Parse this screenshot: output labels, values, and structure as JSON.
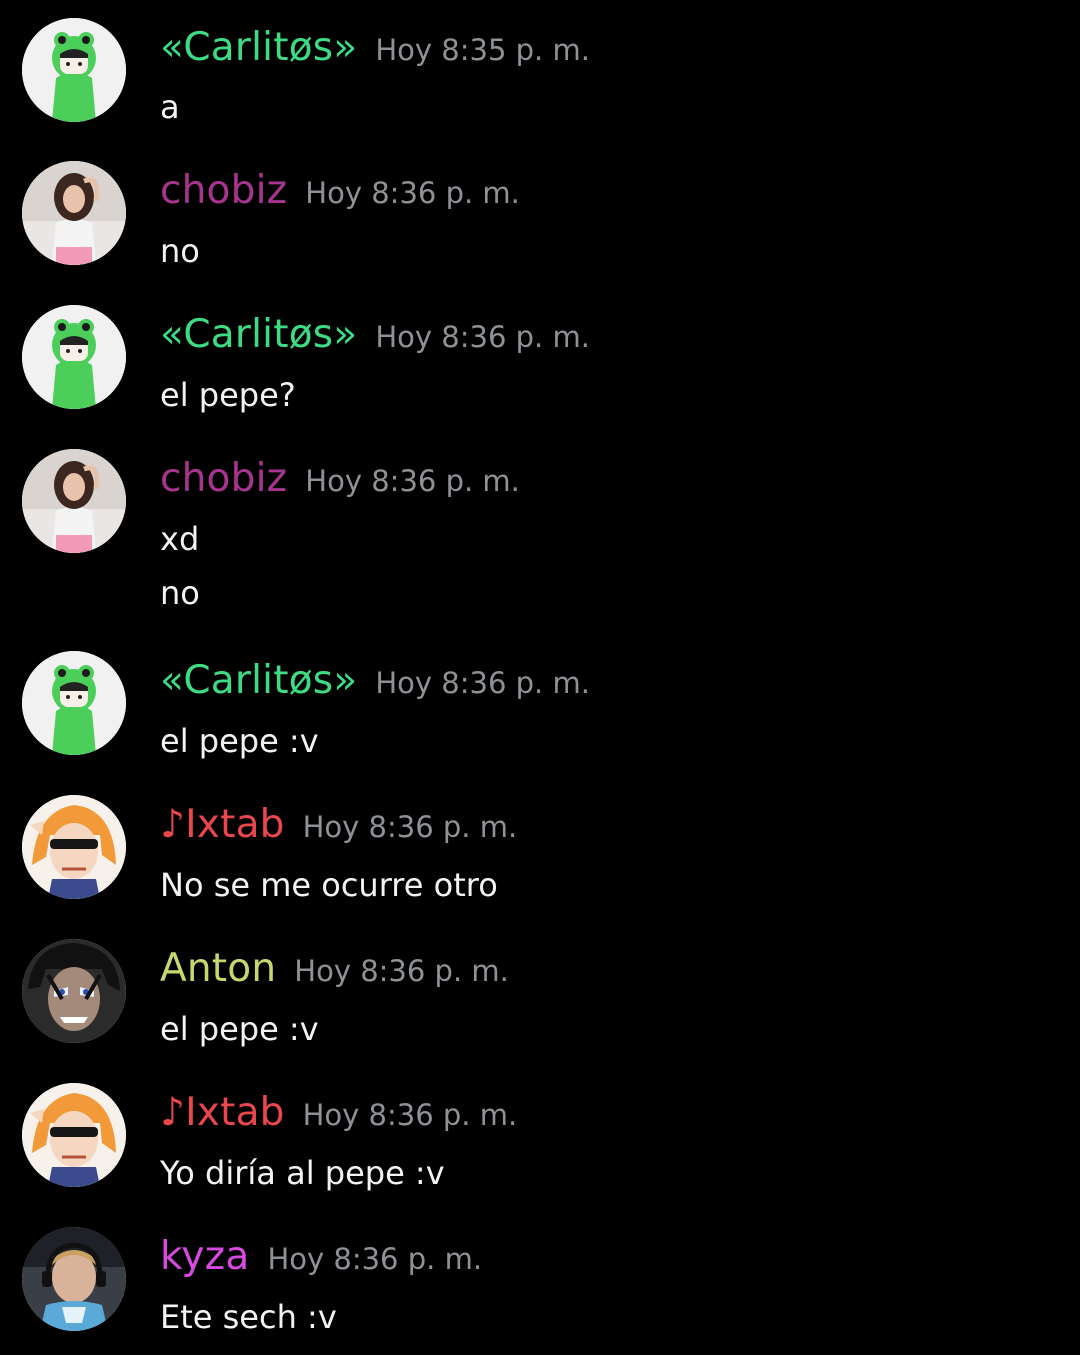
{
  "colors": {
    "background": "#000000",
    "timestamp": "#8e9297",
    "message_text": "#f2f3f5"
  },
  "messages": [
    {
      "author": "«Carlitøs»",
      "author_color": "#3ddc84",
      "avatar": "frog-hood-avatar-icon",
      "timestamp": "Hoy 8:35 p. m.",
      "lines": [
        "a"
      ]
    },
    {
      "author": "chobiz",
      "author_color": "#a7358f",
      "avatar": "girl-photo-avatar-icon",
      "timestamp": "Hoy 8:36 p. m.",
      "lines": [
        "no"
      ]
    },
    {
      "author": "«Carlitøs»",
      "author_color": "#3ddc84",
      "avatar": "frog-hood-avatar-icon",
      "timestamp": "Hoy 8:36 p. m.",
      "lines": [
        "el pepe?"
      ]
    },
    {
      "author": "chobiz",
      "author_color": "#a7358f",
      "avatar": "girl-photo-avatar-icon",
      "timestamp": "Hoy 8:36 p. m.",
      "lines": [
        "xd",
        "no"
      ]
    },
    {
      "author": "«Carlitøs»",
      "author_color": "#3ddc84",
      "avatar": "frog-hood-avatar-icon",
      "timestamp": "Hoy 8:36 p. m.",
      "lines": [
        "el pepe :v"
      ]
    },
    {
      "author": "♪Ixtab",
      "author_color": "#e8484b",
      "avatar": "sunglasses-anime-avatar-icon",
      "timestamp": "Hoy 8:36 p. m.",
      "lines": [
        "No se me ocurre otro"
      ]
    },
    {
      "author": "Anton",
      "author_color": "#c5d86d",
      "avatar": "dark-anime-avatar-icon",
      "timestamp": "Hoy 8:36 p. m.",
      "lines": [
        "el pepe :v"
      ]
    },
    {
      "author": "♪Ixtab",
      "author_color": "#e8484b",
      "avatar": "sunglasses-anime-avatar-icon",
      "timestamp": "Hoy 8:36 p. m.",
      "lines": [
        "Yo diría al pepe :v"
      ]
    },
    {
      "author": "kyza",
      "author_color": "#d64ae0",
      "avatar": "headset-gamer-avatar-icon",
      "timestamp": "Hoy 8:36 p. m.",
      "lines": [
        "Ete sech :v"
      ]
    }
  ]
}
